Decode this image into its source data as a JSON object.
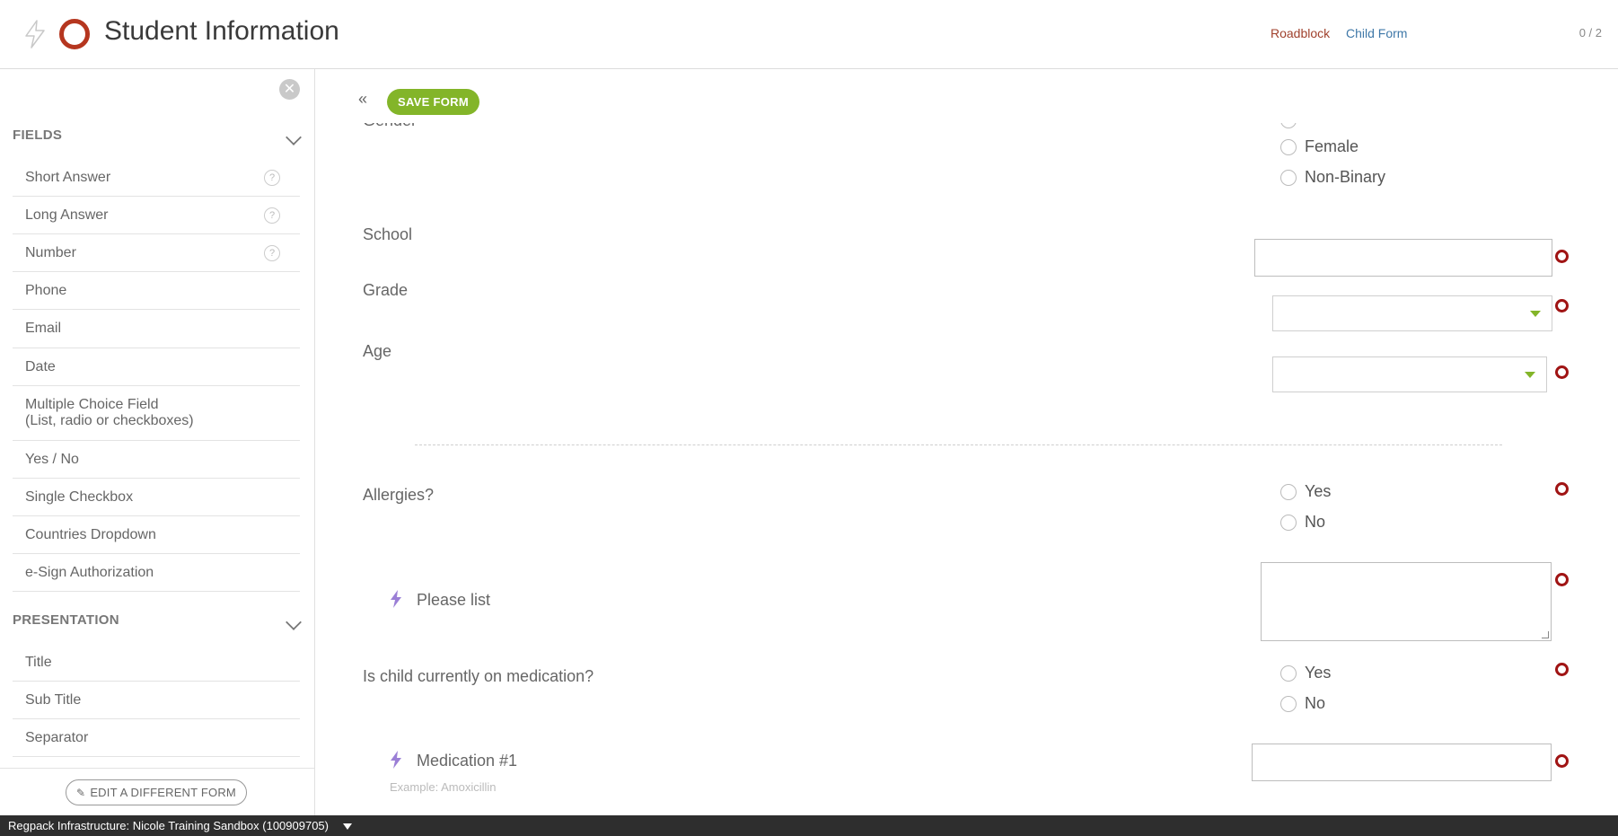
{
  "header": {
    "title": "Student Information",
    "links": {
      "roadblock": "Roadblock",
      "child_form": "Child Form"
    },
    "counter": "0 / 2"
  },
  "sidebar": {
    "close_icon": "close-icon",
    "fields_section": {
      "label": "FIELDS"
    },
    "fields": [
      {
        "label": "Short Answer",
        "help": "?"
      },
      {
        "label": "Long Answer",
        "help": "?"
      },
      {
        "label": "Number",
        "help": "?"
      },
      {
        "label": "Phone"
      },
      {
        "label": "Email"
      },
      {
        "label": "Date"
      },
      {
        "label": "Multiple Choice Field",
        "label2": "(List, radio or checkboxes)"
      },
      {
        "label": "Yes / No"
      },
      {
        "label": "Single Checkbox"
      },
      {
        "label": "Countries Dropdown"
      },
      {
        "label": "e-Sign Authorization"
      }
    ],
    "presentation_section": {
      "label": "PRESENTATION"
    },
    "presentation": [
      {
        "label": "Title"
      },
      {
        "label": "Sub Title"
      },
      {
        "label": "Separator"
      }
    ],
    "footer": {
      "edit_label": "EDIT A DIFFERENT FORM"
    }
  },
  "toolbar": {
    "collapse_label": "«",
    "save_label": "SAVE FORM"
  },
  "form": {
    "gender": {
      "label": "Gender",
      "options": [
        "Female",
        "Non-Binary"
      ]
    },
    "school": {
      "label": "School",
      "value": ""
    },
    "grade": {
      "label": "Grade",
      "value": ""
    },
    "age": {
      "label": "Age",
      "value": ""
    },
    "allergies": {
      "label": "Allergies?",
      "options": [
        "Yes",
        "No"
      ]
    },
    "please_list": {
      "label": "Please list",
      "value": ""
    },
    "medication": {
      "label": "Is child currently on medication?",
      "options": [
        "Yes",
        "No"
      ]
    },
    "medication_1": {
      "label": "Medication #1",
      "hint": "Example: Amoxicillin",
      "value": ""
    }
  },
  "status_bar": {
    "label": "Regpack Infrastructure: Nicole Training Sandbox (100909705)"
  },
  "colors": {
    "accent_green": "#83b529",
    "required_red": "#a01414",
    "brand_ring": "#b5361f",
    "link_blue": "#3f78a8",
    "link_roadblock": "#a0412d",
    "conditional_bolt": "#9b7fd6"
  }
}
